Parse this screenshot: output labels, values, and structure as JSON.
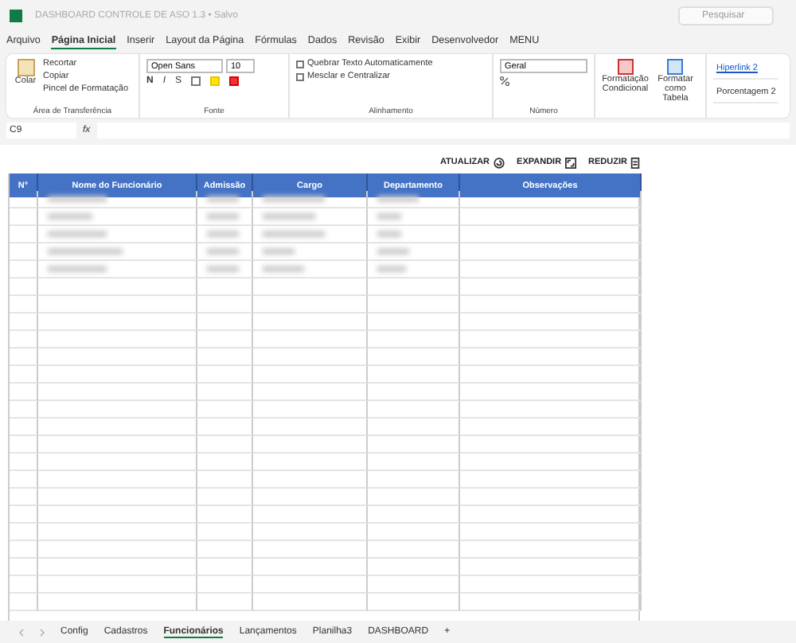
{
  "window": {
    "title": "DASHBOARD CONTROLE DE ASO 1.3 • Salvo",
    "search_placeholder": "Pesquisar"
  },
  "menu_tabs": [
    {
      "label": "Arquivo",
      "selected": false
    },
    {
      "label": "Página Inicial",
      "selected": true
    },
    {
      "label": "Inserir",
      "selected": false
    },
    {
      "label": "Layout da Página",
      "selected": false
    },
    {
      "label": "Fórmulas",
      "selected": false
    },
    {
      "label": "Dados",
      "selected": false
    },
    {
      "label": "Revisão",
      "selected": false
    },
    {
      "label": "Exibir",
      "selected": false
    },
    {
      "label": "Desenvolvedor",
      "selected": false
    },
    {
      "label": "MENU",
      "selected": false
    }
  ],
  "ribbon": {
    "clipboard": {
      "paste": "Colar",
      "cut": "Recortar",
      "copy": "Copiar",
      "format_painter": "Pincel de Formatação",
      "group": "Área de Transferência"
    },
    "font": {
      "name": "Open Sans",
      "size": "10",
      "bold": "N",
      "italic": "I",
      "underline": "S",
      "group": "Fonte"
    },
    "alignment": {
      "wrap": "Quebrar Texto Automaticamente",
      "merge": "Mesclar e Centralizar",
      "group": "Alinhamento"
    },
    "number": {
      "format": "Geral",
      "group": "Número"
    },
    "styles": {
      "conditional": "Formatação Condicional",
      "as_table": "Formatar como Tabela",
      "style_1": "Hiperlink 2",
      "style_2": "Porcentagem 2"
    }
  },
  "formula_bar": {
    "cell": "C9",
    "fx": "fx"
  },
  "sheet_buttons": [
    {
      "label": "ATUALIZAR",
      "kind": "refresh"
    },
    {
      "label": "EXPANDIR",
      "kind": "expand"
    },
    {
      "label": "REDUZIR",
      "kind": "reduce"
    }
  ],
  "table": {
    "columns": [
      "N°",
      "Nome do Funcionário",
      "Admissão",
      "Cargo",
      "Departamento",
      "Observações"
    ]
  },
  "sheet_tabs": [
    {
      "label": "Config",
      "selected": false
    },
    {
      "label": "Cadastros",
      "selected": false
    },
    {
      "label": "Funcionários",
      "selected": true
    },
    {
      "label": "Lançamentos",
      "selected": false
    },
    {
      "label": "Planilha3",
      "selected": false
    },
    {
      "label": "DASHBOARD",
      "selected": false
    }
  ],
  "add_sheet": "+"
}
